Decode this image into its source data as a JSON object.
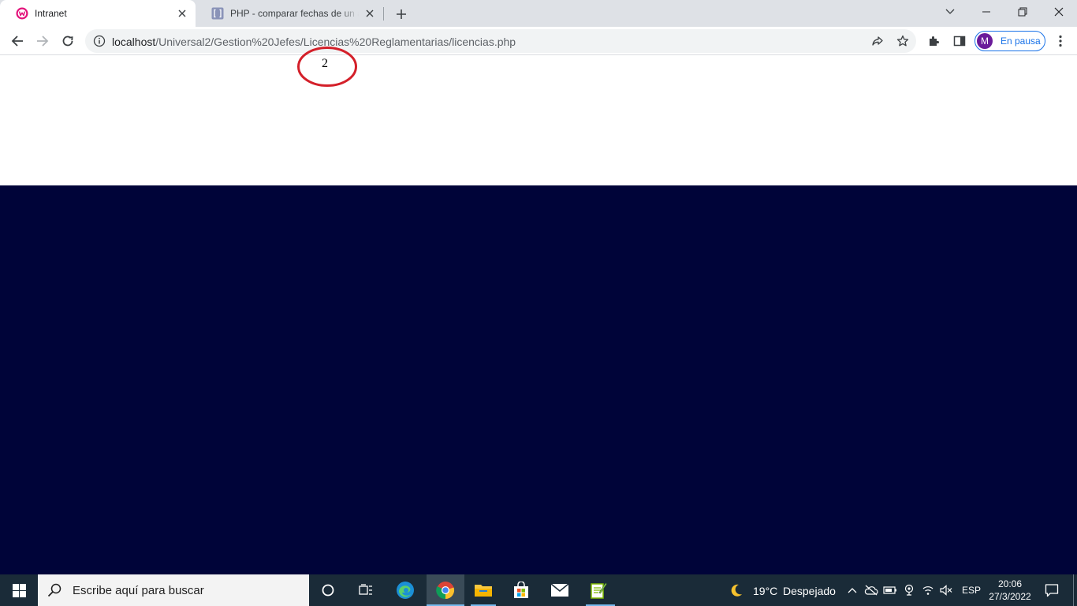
{
  "browser": {
    "tabs": [
      {
        "title": "Intranet",
        "active": true
      },
      {
        "title": "PHP - comparar fechas de un array",
        "active": false
      }
    ],
    "url": {
      "host": "localhost",
      "path": "/Universal2/Gestion%20Jefes/Licencias%20Reglamentarias/licencias.php"
    },
    "profile": {
      "initial": "M",
      "status": "En pausa"
    }
  },
  "page": {
    "counter_value": "2",
    "colors": {
      "top": "#ffffff",
      "band": "#000439",
      "annotation": "#d4202a"
    }
  },
  "taskbar": {
    "search_placeholder": "Escribe aquí para buscar",
    "weather": {
      "temp": "19°C",
      "condition": "Despejado"
    },
    "language": "ESP",
    "time": "20:06",
    "date": "27/3/2022"
  }
}
